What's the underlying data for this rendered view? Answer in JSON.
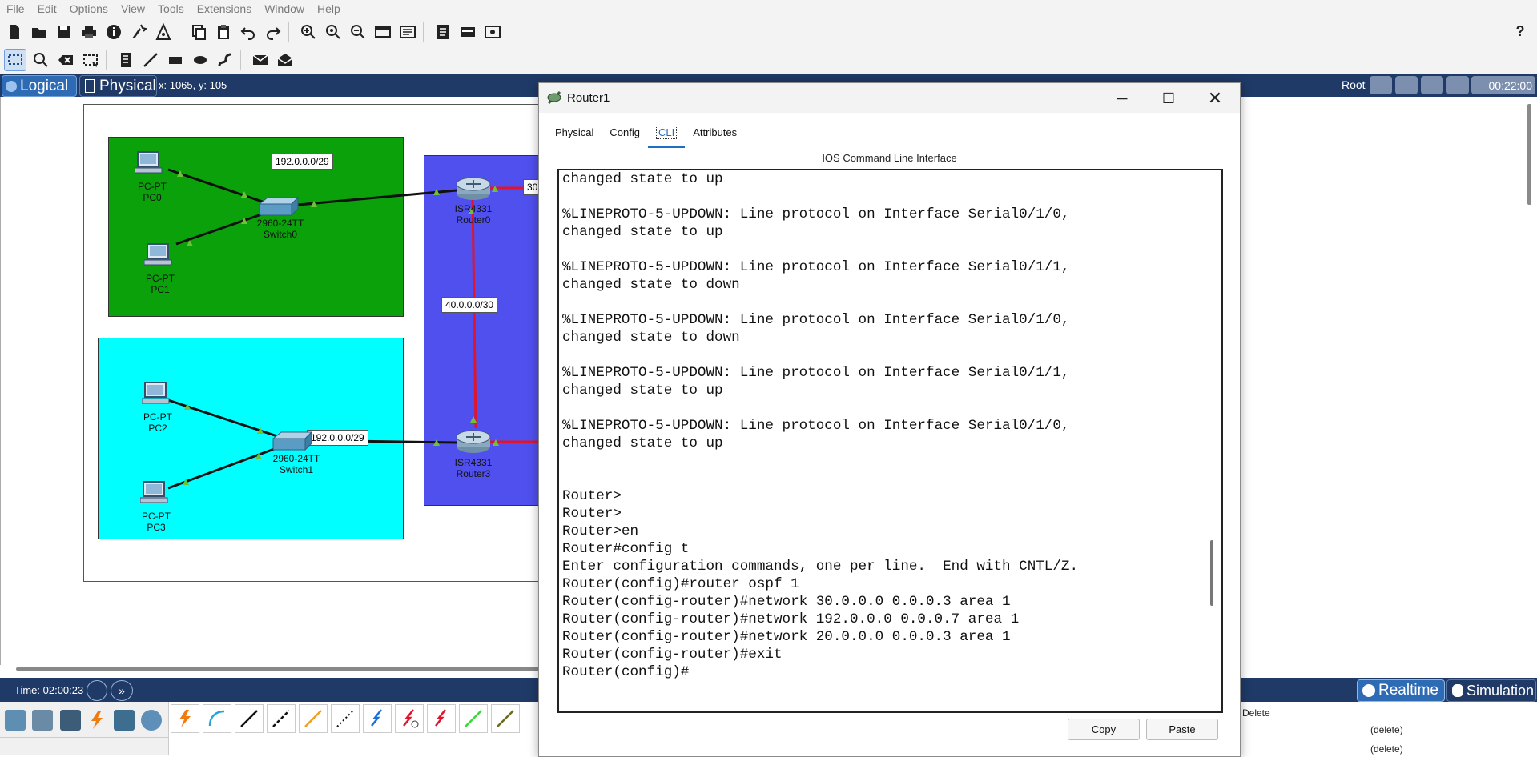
{
  "menu": [
    "File",
    "Edit",
    "Options",
    "View",
    "Tools",
    "Extensions",
    "Window",
    "Help"
  ],
  "toolbar": {
    "icons1": [
      "new-file-icon",
      "open-folder-icon",
      "save-icon",
      "print-icon",
      "info-icon",
      "activity-wizard-icon",
      "wizard-icon",
      "copy-icon",
      "paste-icon",
      "undo-icon",
      "redo-icon",
      "zoom-in-icon",
      "zoom-reset-icon",
      "zoom-out-icon",
      "drawing-palette-icon",
      "custom-device-icon",
      "notes-icon",
      "layout-icon",
      "screenshot-icon"
    ],
    "help_label": "?",
    "icons2": [
      "select-icon",
      "inspect-icon",
      "delete-icon",
      "resize-icon",
      "place-note-icon",
      "draw-line-icon",
      "rectangle-icon",
      "ellipse-icon",
      "freeform-icon",
      "simple-pdu-icon",
      "complex-pdu-icon"
    ]
  },
  "modebar": {
    "logical": "Logical",
    "physical": "Physical",
    "coords": "x: 1065, y: 105",
    "root": "Root",
    "clock": "00:22:00"
  },
  "topology": {
    "networks": [
      "192.0.0.0/29",
      "40.0.0.0/30",
      "192.0.0.0/29",
      "30"
    ],
    "pc0": {
      "type": "PC-PT",
      "name": "PC0"
    },
    "pc1": {
      "type": "PC-PT",
      "name": "PC1"
    },
    "pc2": {
      "type": "PC-PT",
      "name": "PC2"
    },
    "pc3": {
      "type": "PC-PT",
      "name": "PC3"
    },
    "switch0": {
      "type": "2960-24TT",
      "name": "Switch0"
    },
    "switch1": {
      "type": "2960-24TT",
      "name": "Switch1"
    },
    "router0": {
      "type": "ISR4331",
      "name": "Router0"
    },
    "router3": {
      "type": "ISR4331",
      "name": "Router3"
    }
  },
  "timebar": {
    "time": "Time: 02:00:23",
    "realtime": "Realtime",
    "simulation": "Simulation"
  },
  "pdu_panel": {
    "delete_header": "Delete",
    "rows": [
      "(delete)",
      "(delete)"
    ]
  },
  "router_window": {
    "title": "Router1",
    "tabs": [
      "Physical",
      "Config",
      "CLI",
      "Attributes"
    ],
    "active_tab": "CLI",
    "heading": "IOS Command Line Interface",
    "cli_lines": [
      "changed state to up",
      "",
      "%LINEPROTO-5-UPDOWN: Line protocol on Interface Serial0/1/0,",
      "changed state to up",
      "",
      "%LINEPROTO-5-UPDOWN: Line protocol on Interface Serial0/1/1,",
      "changed state to down",
      "",
      "%LINEPROTO-5-UPDOWN: Line protocol on Interface Serial0/1/0,",
      "changed state to down",
      "",
      "%LINEPROTO-5-UPDOWN: Line protocol on Interface Serial0/1/1,",
      "changed state to up",
      "",
      "%LINEPROTO-5-UPDOWN: Line protocol on Interface Serial0/1/0,",
      "changed state to up",
      "",
      "",
      "Router>",
      "Router>",
      "Router>en",
      "Router#config t",
      "Enter configuration commands, one per line.  End with CNTL/Z.",
      "Router(config)#router ospf 1",
      "Router(config-router)#network 30.0.0.0 0.0.0.3 area 1",
      "Router(config-router)#network 192.0.0.0 0.0.0.7 area 1",
      "Router(config-router)#network 20.0.0.0 0.0.0.3 area 1",
      "Router(config-router)#exit",
      "Router(config)#"
    ],
    "copy": "Copy",
    "paste": "Paste"
  },
  "colors": {
    "accent_blue": "#1f3a66",
    "green_area": "#0aa10a",
    "cyan_area": "#00ffff",
    "blue_area": "#5050ef",
    "serial_link": "#e0142b"
  }
}
